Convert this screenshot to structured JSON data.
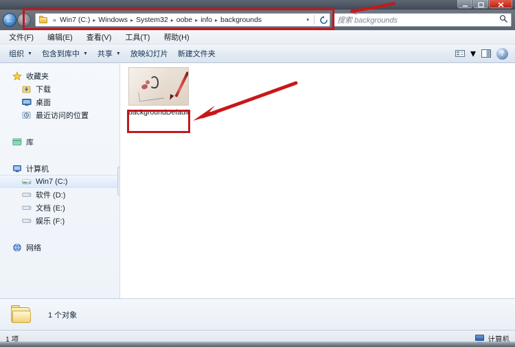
{
  "window": {
    "controls": {
      "minimize_label": "minimize",
      "maximize_label": "maximize",
      "close_label": "close"
    }
  },
  "addressbar": {
    "back_label": "后退",
    "forward_label": "前进",
    "folder_icon": "folder-icon",
    "overflow": "«",
    "crumbs": [
      "Win7 (C:)",
      "Windows",
      "System32",
      "oobe",
      "info",
      "backgrounds"
    ],
    "separator": "▸",
    "dropdown": "▾",
    "refresh_label": "刷新",
    "search_placeholder": "搜索 backgrounds",
    "search_value": "",
    "search_icon": "search-icon"
  },
  "menubar": {
    "items": [
      {
        "label": "文件(F)"
      },
      {
        "label": "编辑(E)"
      },
      {
        "label": "查看(V)"
      },
      {
        "label": "工具(T)"
      },
      {
        "label": "帮助(H)"
      }
    ]
  },
  "toolbar": {
    "items": [
      {
        "label": "组织",
        "has_dropdown": true
      },
      {
        "label": "包含到库中",
        "has_dropdown": true
      },
      {
        "label": "共享",
        "has_dropdown": true
      },
      {
        "label": "放映幻灯片",
        "has_dropdown": false
      },
      {
        "label": "新建文件夹",
        "has_dropdown": false
      }
    ],
    "right": {
      "view_icon": "view-layout-icon",
      "view_dropdown": "▾",
      "preview_pane_icon": "preview-pane-icon",
      "help_icon": "help-icon",
      "help_glyph": "?"
    }
  },
  "navpane": {
    "groups": [
      {
        "header": {
          "label": "收藏夹",
          "icon": "star-icon"
        },
        "items": [
          {
            "label": "下载",
            "icon": "downloads-icon"
          },
          {
            "label": "桌面",
            "icon": "desktop-icon"
          },
          {
            "label": "最近访问的位置",
            "icon": "recent-places-icon"
          }
        ]
      },
      {
        "header": {
          "label": "库",
          "icon": "library-icon"
        },
        "items": []
      },
      {
        "header": {
          "label": "计算机",
          "icon": "computer-icon"
        },
        "items": [
          {
            "label": "Win7 (C:)",
            "icon": "hard-drive-icon",
            "selected": true
          },
          {
            "label": "软件 (D:)",
            "icon": "drive-icon",
            "selected": false
          },
          {
            "label": "文档 (E:)",
            "icon": "drive-icon",
            "selected": false
          },
          {
            "label": "娱乐 (F:)",
            "icon": "drive-icon",
            "selected": false
          }
        ]
      },
      {
        "header": {
          "label": "网络",
          "icon": "network-icon"
        },
        "items": []
      }
    ]
  },
  "filepane": {
    "files": [
      {
        "name": "backgroundDefault",
        "icon": "image-thumbnail",
        "highlighted": true
      }
    ]
  },
  "detailspane": {
    "icon": "folder-icon",
    "text": "1 个对象"
  },
  "statusbar": {
    "left_text": "1 项",
    "right_text": "计算机",
    "right_icon": "computer-icon"
  },
  "annotations": {
    "address_box_color": "#c0181c",
    "file_box_color": "#c0181c",
    "arrow_color": "#c8171b",
    "arrow_top_name": "arrow-pointing-to-address-bar",
    "arrow_main_name": "arrow-pointing-to-file"
  }
}
